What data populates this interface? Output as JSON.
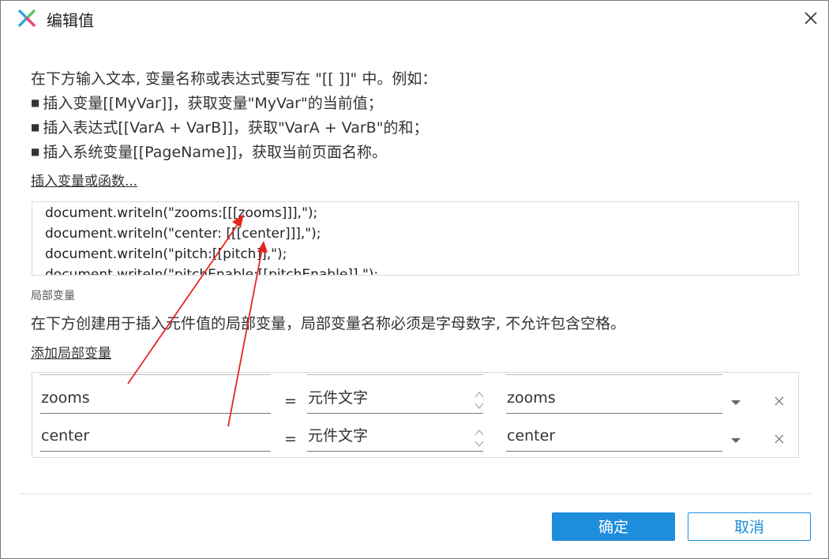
{
  "window": {
    "title": "编辑值"
  },
  "intro": {
    "line1": "在下方输入文本, 变量名称或表达式要写在 \"[[ ]]\" 中。例如：",
    "bullets": [
      "插入变量[[MyVar]]，获取变量\"MyVar\"的当前值；",
      "插入表达式[[VarA + VarB]]，获取\"VarA + VarB\"的和；",
      "插入系统变量[[PageName]]，获取当前页面名称。"
    ],
    "bullet_char": "■"
  },
  "insert_link": "插入变量或函数...",
  "editor": {
    "lines": [
      "document.writeln(\"zooms:[[[zooms]]],\");",
      "document.writeln(\"center: [[[center]]],\");",
      "document.writeln(\"pitch:[[pitch]],\");",
      "document.writeln(\"pitchEnable:[[pitchEnable]],\");"
    ]
  },
  "local_vars": {
    "section_label": "局部变量",
    "description": "在下方创建用于插入元件值的局部变量，局部变量名称必须是字母数字, 不允许包含空格。",
    "add_link": "添加局部变量",
    "equals": "=",
    "rows": [
      {
        "name": "zooms",
        "type": "元件文字",
        "target": "zooms"
      },
      {
        "name": "center",
        "type": "元件文字",
        "target": "center"
      }
    ]
  },
  "footer": {
    "ok_label": "确定",
    "cancel_label": "取消"
  },
  "colors": {
    "accent": "#1e8ddb",
    "annotation_red": "#e5251f",
    "logo_blue": "#2aa8e0",
    "logo_green": "#5cc36b"
  },
  "icons": {
    "app": "axure-x-logo-icon",
    "close": "close-icon",
    "spinner": "spinner-arrows-icon",
    "dropdown": "dropdown-triangle-icon",
    "delete": "delete-x-icon"
  }
}
